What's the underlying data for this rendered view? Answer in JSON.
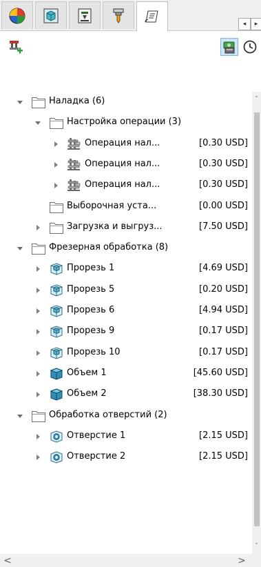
{
  "tabs": [
    {
      "icon": "feature-pie-icon",
      "active": false
    },
    {
      "icon": "part-manager-icon",
      "active": false
    },
    {
      "icon": "setup-sheet-icon",
      "active": false
    },
    {
      "icon": "tool-tree-icon",
      "active": false
    },
    {
      "icon": "cost-tree-icon",
      "active": true
    }
  ],
  "tab_scroll": {
    "left": "◂",
    "right": "▸"
  },
  "toolbar": {
    "left_button": "add-setup-icon",
    "right_buttons": [
      "cost-view-icon",
      "time-view-icon"
    ]
  },
  "tree": [
    {
      "level": 0,
      "arrow": "expanded",
      "icon": "folder-icon",
      "label": "Наладка (6)",
      "cost": ""
    },
    {
      "level": 1,
      "arrow": "expanded",
      "icon": "folder-icon",
      "label": "Настройка операции (3)",
      "cost": ""
    },
    {
      "level": 2,
      "arrow": "collapsed",
      "icon": "operation-setup-icon",
      "label": "Операция нал...",
      "cost": "[0.30 USD]"
    },
    {
      "level": 2,
      "arrow": "collapsed",
      "icon": "operation-setup-icon",
      "label": "Операция нал...",
      "cost": "[0.30 USD]"
    },
    {
      "level": 2,
      "arrow": "collapsed",
      "icon": "operation-setup-icon",
      "label": "Операция нал...",
      "cost": "[0.30 USD]"
    },
    {
      "level": 1,
      "arrow": "none",
      "icon": "folder-icon",
      "label": "Выборочная уста...",
      "cost": "[0.00 USD]"
    },
    {
      "level": 1,
      "arrow": "collapsed",
      "icon": "folder-icon",
      "label": "Загрузка и выгруз...",
      "cost": "[7.50 USD]"
    },
    {
      "level": 0,
      "arrow": "expanded",
      "icon": "folder-icon",
      "label": "Фрезерная обработка (8)",
      "cost": ""
    },
    {
      "level": 1,
      "arrow": "collapsed",
      "icon": "slot-feature-icon",
      "label": "Прорезь 1",
      "cost": "[4.69 USD]"
    },
    {
      "level": 1,
      "arrow": "collapsed",
      "icon": "slot-feature-icon",
      "label": "Прорезь 5",
      "cost": "[0.20 USD]"
    },
    {
      "level": 1,
      "arrow": "collapsed",
      "icon": "slot-feature-icon",
      "label": "Прорезь 6",
      "cost": "[4.94 USD]"
    },
    {
      "level": 1,
      "arrow": "collapsed",
      "icon": "slot-feature-icon",
      "label": "Прорезь 9",
      "cost": "[0.17 USD]"
    },
    {
      "level": 1,
      "arrow": "collapsed",
      "icon": "slot-feature-icon",
      "label": "Прорезь 10",
      "cost": "[0.17 USD]"
    },
    {
      "level": 1,
      "arrow": "collapsed",
      "icon": "volume-feature-icon",
      "label": "Объем 1",
      "cost": "[45.60 USD]"
    },
    {
      "level": 1,
      "arrow": "collapsed",
      "icon": "volume-feature-icon",
      "label": "Объем 2",
      "cost": "[38.30 USD]"
    },
    {
      "level": 0,
      "arrow": "expanded",
      "icon": "folder-icon",
      "label": "Обработка отверстий (2)",
      "cost": ""
    },
    {
      "level": 1,
      "arrow": "collapsed",
      "icon": "hole-feature-icon",
      "label": "Отверстие 1",
      "cost": "[2.15 USD]"
    },
    {
      "level": 1,
      "arrow": "collapsed",
      "icon": "hole-feature-icon",
      "label": "Отверстие 2",
      "cost": "[2.15 USD]"
    }
  ],
  "scrollbar": {
    "up": "˄",
    "down": "˅",
    "left": "<",
    "right": ">"
  },
  "colors": {
    "folder": "#ffffff",
    "folder_border": "#707070",
    "arrow": "#707070",
    "selected_button": "#cfe5fa"
  }
}
